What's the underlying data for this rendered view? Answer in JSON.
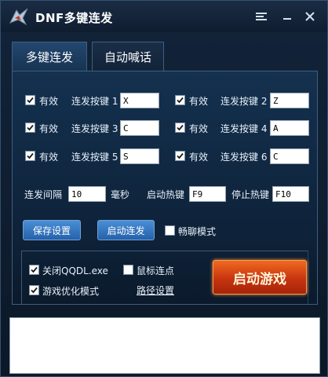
{
  "window": {
    "title": "DNF多键连发"
  },
  "titlebar": {
    "logo_icon": "dragon-logo-icon",
    "settings_icon": "settings-icon",
    "minimize_icon": "minimize-icon",
    "close_icon": "close-icon"
  },
  "tabs": [
    {
      "label": "多键连发",
      "active": true
    },
    {
      "label": "自动喊话",
      "active": false
    }
  ],
  "key_rows": [
    {
      "enabled_label": "有效",
      "key_label": "连发按键 1",
      "value": "X",
      "checked": true
    },
    {
      "enabled_label": "有效",
      "key_label": "连发按键 2",
      "value": "Z",
      "checked": true
    },
    {
      "enabled_label": "有效",
      "key_label": "连发按键 3",
      "value": "C",
      "checked": true
    },
    {
      "enabled_label": "有效",
      "key_label": "连发按键 4",
      "value": "A",
      "checked": true
    },
    {
      "enabled_label": "有效",
      "key_label": "连发按键 5",
      "value": "S",
      "checked": true
    },
    {
      "enabled_label": "有效",
      "key_label": "连发按键 6",
      "value": "C",
      "checked": true
    }
  ],
  "interval": {
    "label": "连发间隔",
    "value": "10",
    "unit": "毫秒"
  },
  "start_hotkey": {
    "label": "启动热键",
    "value": "F9"
  },
  "stop_hotkey": {
    "label": "停止热键",
    "value": "F10"
  },
  "actions": {
    "save_label": "保存设置",
    "start_label": "启动连发",
    "chat_mode_label": "畅聊模式",
    "chat_mode_checked": false
  },
  "options": {
    "close_qqdl_label": "关闭QQDL.exe",
    "close_qqdl_checked": true,
    "mouse_click_label": "鼠标连点",
    "mouse_click_checked": false,
    "game_optimize_label": "游戏优化模式",
    "game_optimize_checked": true,
    "path_settings_label": "路径设置"
  },
  "start_game_label": "启动游戏",
  "log": {
    "content": ""
  },
  "colors": {
    "accent_blue": "#2f6fb8",
    "start_game_orange": "#d9441a",
    "window_bg": "#0c1827"
  }
}
